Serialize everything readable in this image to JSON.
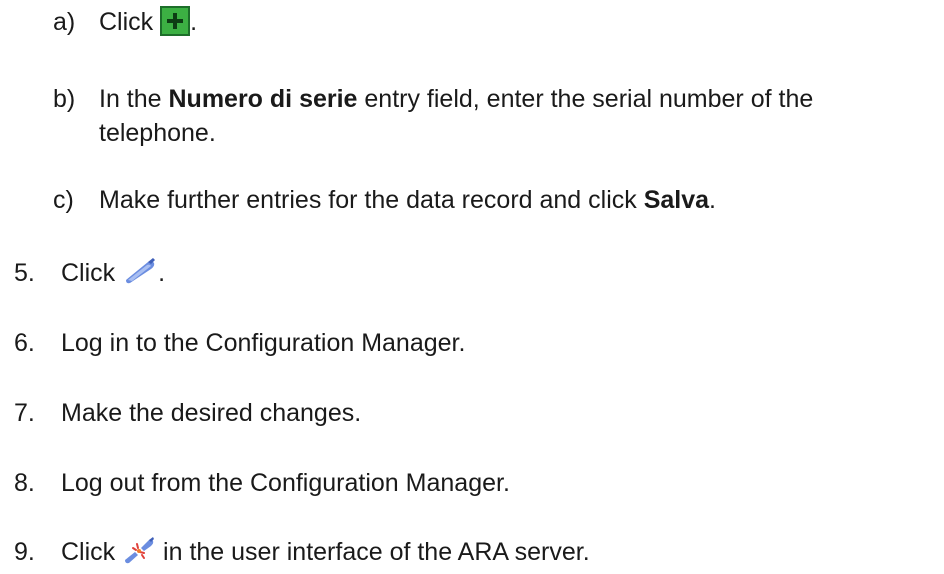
{
  "steps": {
    "a": {
      "marker": "a)",
      "before": "Click ",
      "after": ".",
      "icon": "green-plus-add-icon",
      "icon_color": "#3cb043"
    },
    "b": {
      "marker": "b)",
      "before": "In the ",
      "bold": "Numero di serie",
      "after": " entry field, enter the serial number of the",
      "continuation": "telephone."
    },
    "c": {
      "marker": "c)",
      "before": "Make further entries for the data record and click ",
      "bold": "Salva",
      "after": "."
    },
    "s5": {
      "marker": "5.",
      "before": "Click ",
      "after": ".",
      "icon": "connect-plug-icon",
      "icon_color": "#5b7fd6"
    },
    "s6": {
      "marker": "6.",
      "text": "Log in to the Configuration Manager."
    },
    "s7": {
      "marker": "7.",
      "text": "Make the desired changes."
    },
    "s8": {
      "marker": "8.",
      "text": "Log out from the Configuration Manager."
    },
    "s9": {
      "marker": "9.",
      "before": "Click ",
      "after": " in the user interface of the ARA server.",
      "icon": "disconnect-plug-icon",
      "icon_color": "#5b7fd6"
    }
  }
}
